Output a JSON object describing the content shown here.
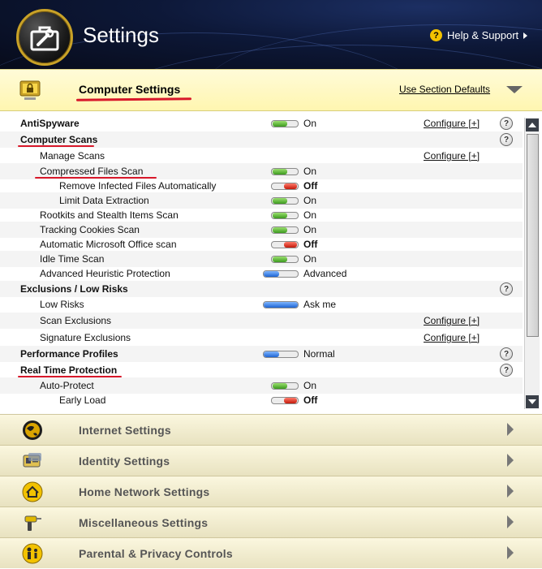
{
  "header": {
    "title": "Settings",
    "help_label": "Help & Support"
  },
  "section": {
    "title": "Computer Settings",
    "defaults_link": "Use Section Defaults"
  },
  "rows": [
    {
      "label": "AntiSpyware",
      "level": 0,
      "bold": true,
      "toggle": "on",
      "state": "On",
      "configure": "Configure [+]",
      "help": true
    },
    {
      "label": "Computer Scans",
      "level": 0,
      "bold": true,
      "help": true
    },
    {
      "label": "Manage Scans",
      "level": 1,
      "configure": "Configure [+]"
    },
    {
      "label": "Compressed Files Scan",
      "level": 1,
      "toggle": "on",
      "state": "On"
    },
    {
      "label": "Remove Infected Files Automatically",
      "level": 2,
      "toggle": "off",
      "state": "Off",
      "stateBold": true
    },
    {
      "label": "Limit Data Extraction",
      "level": 2,
      "toggle": "on",
      "state": "On"
    },
    {
      "label": "Rootkits and Stealth Items Scan",
      "level": 1,
      "toggle": "on",
      "state": "On"
    },
    {
      "label": "Tracking Cookies Scan",
      "level": 1,
      "toggle": "on",
      "state": "On"
    },
    {
      "label": "Automatic Microsoft Office scan",
      "level": 1,
      "toggle": "off",
      "state": "Off",
      "stateBold": true
    },
    {
      "label": "Idle Time Scan",
      "level": 1,
      "toggle": "on",
      "state": "On"
    },
    {
      "label": "Advanced Heuristic Protection",
      "level": 1,
      "slider": 0.45,
      "state": "Advanced"
    },
    {
      "label": "Exclusions / Low Risks",
      "level": 0,
      "bold": true,
      "help": true
    },
    {
      "label": "Low Risks",
      "level": 1,
      "slider": 1.0,
      "state": "Ask me"
    },
    {
      "label": "Scan Exclusions",
      "level": 1,
      "configure": "Configure [+]"
    },
    {
      "label": "Signature Exclusions",
      "level": 1,
      "configure": "Configure [+]"
    },
    {
      "label": "Performance Profiles",
      "level": 0,
      "bold": true,
      "slider": 0.45,
      "state": "Normal",
      "help": true
    },
    {
      "label": "Real Time Protection",
      "level": 0,
      "bold": true,
      "help": true
    },
    {
      "label": "Auto-Protect",
      "level": 1,
      "toggle": "on",
      "state": "On"
    },
    {
      "label": "Early Load",
      "level": 2,
      "toggle": "off",
      "state": "Off",
      "stateBold": true
    }
  ],
  "categories": [
    {
      "label": "Internet Settings",
      "icon": "globe-icon"
    },
    {
      "label": "Identity Settings",
      "icon": "id-card-icon"
    },
    {
      "label": "Home Network Settings",
      "icon": "home-network-icon"
    },
    {
      "label": "Miscellaneous Settings",
      "icon": "drill-icon"
    },
    {
      "label": "Parental & Privacy Controls",
      "icon": "family-icon"
    }
  ],
  "colors": {
    "annotation_red": "#d8182a",
    "section_bg": "#fff6b0",
    "header_bg": "#0d1838"
  }
}
